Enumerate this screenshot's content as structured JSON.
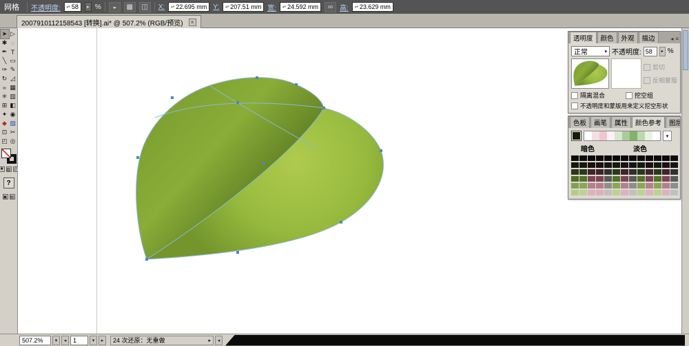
{
  "top_bar": {
    "title": "网格",
    "opacity_label": "不透明度:",
    "opacity_value": "58",
    "percent": "%",
    "x_label": "X:",
    "x_value": "22.695 mm",
    "y_label": "Y:",
    "y_value": "207.51 mm",
    "w_label": "宽:",
    "w_value": "24.592 mm",
    "h_label": "高:",
    "h_value": "23.629 mm"
  },
  "doc_tab": {
    "title": "2007910112158543 [转换].ai* @ 507.2% (RGB/预览)",
    "close_glyph": "×"
  },
  "toolbar": {
    "tools": [
      {
        "name": "selection-tool",
        "glyph": "➤",
        "active": true
      },
      {
        "name": "direct-selection-tool",
        "glyph": "▷"
      },
      {
        "name": "magic-wand-tool",
        "glyph": "✱"
      },
      {
        "name": "lasso-tool",
        "glyph": "◌"
      },
      {
        "name": "pen-tool",
        "glyph": "✒"
      },
      {
        "name": "type-tool",
        "glyph": "T"
      },
      {
        "name": "line-segment-tool",
        "glyph": "╲"
      },
      {
        "name": "rectangle-tool",
        "glyph": "▭"
      },
      {
        "name": "paintbrush-tool",
        "glyph": "✑"
      },
      {
        "name": "pencil-tool",
        "glyph": "✎"
      },
      {
        "name": "rotate-tool",
        "glyph": "↻"
      },
      {
        "name": "scale-tool",
        "glyph": "◿"
      },
      {
        "name": "warp-tool",
        "glyph": "≈"
      },
      {
        "name": "free-transform-tool",
        "glyph": "▦"
      },
      {
        "name": "symbol-sprayer-tool",
        "glyph": "✳"
      },
      {
        "name": "graph-tool",
        "glyph": "▥"
      },
      {
        "name": "mesh-tool",
        "glyph": "⊞"
      },
      {
        "name": "gradient-tool",
        "glyph": "◧"
      },
      {
        "name": "eyedropper-tool",
        "glyph": "✦"
      },
      {
        "name": "blend-tool",
        "glyph": "◉"
      },
      {
        "name": "live-paint-bucket-tool",
        "glyph": "◆",
        "color": "#b03030"
      },
      {
        "name": "live-paint-selection-tool",
        "glyph": "▧",
        "color": "#3050b0"
      },
      {
        "name": "crop-area-tool",
        "glyph": "⊡"
      },
      {
        "name": "slice-tool",
        "glyph": "✂"
      },
      {
        "name": "hand-tool",
        "glyph": "◰"
      },
      {
        "name": "zoom-tool",
        "glyph": "◎"
      }
    ]
  },
  "canvas": {
    "leaf": {
      "front_center": "#aecb4e",
      "front_mid": "#97ba3e",
      "front_edge": "#73952c",
      "back_light": "#8aac38",
      "back_mid": "#7b9e30",
      "back_dark": "#5a7a20",
      "path_color": "#8cb8d8"
    }
  },
  "right": {
    "transparency": {
      "tabs": [
        "透明度",
        "颜色",
        "外观",
        "描边"
      ],
      "active_tab": "透明度",
      "blend_mode": "正常",
      "opacity_label": "不透明度:",
      "opacity_value": "58",
      "percent": "%",
      "clip_label": "剪切",
      "invert_label": "反相蒙版",
      "isolate_label": "隔离混合",
      "knockout_label": "挖空组",
      "define_label": "不透明度和蒙版用来定义挖空形状"
    },
    "color_guide": {
      "tabs": [
        "色板",
        "画笔",
        "属性",
        "颜色参考",
        "图层"
      ],
      "active_tab": "颜色参考",
      "dark_label": "暗色",
      "light_label": "淡色",
      "base_color": "#161d07",
      "variations": [
        "#ffffff",
        "#f5dfe5",
        "#eec7d1",
        "#f9f2f4",
        "#d8e7cf",
        "#abcb97",
        "#7fb369",
        "#bcd8ae",
        "#e9f2e3",
        "#ffffff"
      ],
      "grid": [
        [
          "#0b0b09",
          "#0a0c08",
          "#0d090b",
          "#0d090b",
          "#0b0b0b",
          "#0a0c08",
          "#0d090b",
          "#0b0b0b",
          "#0a0c08",
          "#0d090b",
          "#0a0c08",
          "#0d090b",
          "#0b0b0b"
        ],
        [
          "#15190c",
          "#141a0d",
          "#1c1014",
          "#1c1014",
          "#161616",
          "#141a0d",
          "#1c1014",
          "#161616",
          "#141a0d",
          "#1c1014",
          "#141a0d",
          "#1c1014",
          "#161616"
        ],
        [
          "#2c3816",
          "#2a3a18",
          "#40242e",
          "#3e222c",
          "#303030",
          "#2a3a18",
          "#40242e",
          "#303030",
          "#2a3a18",
          "#40242e",
          "#2a3a18",
          "#40242e",
          "#303030"
        ],
        [
          "#53692a",
          "#567030",
          "#7c4656",
          "#7a4454",
          "#5a5a5a",
          "#567030",
          "#7c4656",
          "#5a5a5a",
          "#567030",
          "#7c4656",
          "#567030",
          "#7c4656",
          "#5a5a5a"
        ],
        [
          "#82a04a",
          "#88a852",
          "#b87e90",
          "#b67c8e",
          "#8e8e8e",
          "#88a852",
          "#b87e90",
          "#8e8e8e",
          "#88a852",
          "#b87e90",
          "#88a852",
          "#b87e90",
          "#8e8e8e"
        ],
        [
          "#b5cc85",
          "#bcd28e",
          "#dcb2c0",
          "#dab0be",
          "#c0c0c0",
          "#bcd28e",
          "#dcb2c0",
          "#c0c0c0",
          "#bcd28e",
          "#dcb2c0",
          "#bcd28e",
          "#dcb2c0",
          "#c0c0c0"
        ]
      ]
    }
  },
  "status_bar": {
    "zoom": "507.2%",
    "page": "1",
    "undo_status": "24 次还原：无重做"
  }
}
